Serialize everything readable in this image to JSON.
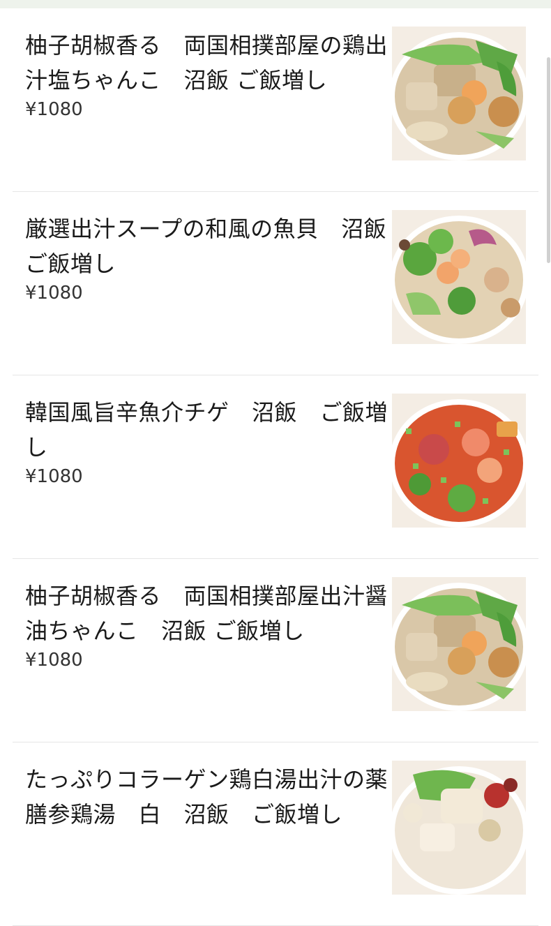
{
  "menu": {
    "items": [
      {
        "title": "柚子胡椒香る　両国相撲部屋の鶏出汁塩ちゃんこ　沼飯 ご飯増し",
        "price": "¥1080",
        "image": "chanko-bowl-photo"
      },
      {
        "title": "厳選出汁スープの和風の魚貝　沼飯　　ご飯増し",
        "price": "¥1080",
        "image": "seafood-bowl-photo"
      },
      {
        "title": "韓国風旨辛魚介チゲ　沼飯　ご飯増し",
        "price": "¥1080",
        "image": "spicy-chige-bowl-photo"
      },
      {
        "title": "柚子胡椒香る　両国相撲部屋出汁醤油ちゃんこ　沼飯 ご飯増し",
        "price": "¥1080",
        "image": "chanko-bowl-photo"
      },
      {
        "title": "たっぷりコラーゲン鶏白湯出汁の薬膳参鶏湯　白　沼飯　ご飯増し",
        "price": "",
        "image": "samgyetang-bowl-photo"
      }
    ]
  },
  "colors": {
    "accent_top": "#eef3ec",
    "text": "#1a1a1a",
    "divider": "#e6e6e6"
  }
}
